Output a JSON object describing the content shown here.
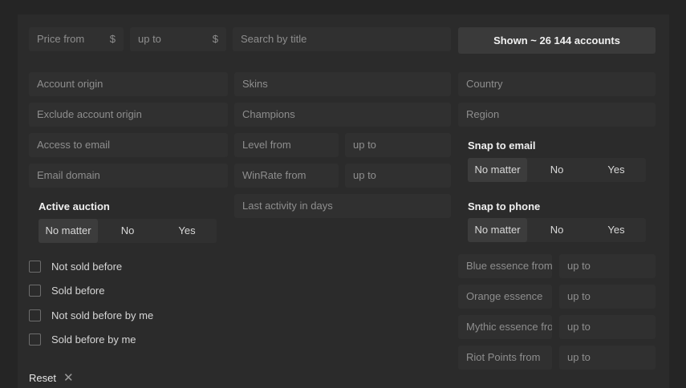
{
  "filters": {
    "price_from": "Price from",
    "price_currency": "$",
    "price_to": "up to",
    "price_to_currency": "$",
    "search_title": "Search by title",
    "shown_button": "Shown ~ 26 144 accounts",
    "account_origin": "Account origin",
    "exclude_account_origin": "Exclude account origin",
    "access_to_email": "Access to email",
    "email_domain": "Email domain",
    "skins": "Skins",
    "champions": "Champions",
    "level_from": "Level from",
    "level_to": "up to",
    "winrate_from": "WinRate from",
    "winrate_to": "up to",
    "last_activity": "Last activity in days",
    "country": "Country",
    "region": "Region",
    "blue_essence_from": "Blue essence from",
    "blue_essence_to": "up to",
    "orange_essence_from": "Orange essence",
    "orange_essence_to": "up to",
    "mythic_essence_from": "Mythic essence from",
    "mythic_essence_to": "up to",
    "riot_points_from": "Riot Points from",
    "riot_points_to": "up to"
  },
  "snap_email": {
    "label": "Snap to email",
    "options": [
      "No matter",
      "No",
      "Yes"
    ],
    "selected": "No matter"
  },
  "snap_phone": {
    "label": "Snap to phone",
    "options": [
      "No matter",
      "No",
      "Yes"
    ],
    "selected": "No matter"
  },
  "active_auction": {
    "label": "Active auction",
    "options": [
      "No matter",
      "No",
      "Yes"
    ],
    "selected": "No matter"
  },
  "checks": [
    {
      "label": "Not sold before",
      "checked": false
    },
    {
      "label": "Sold before",
      "checked": false
    },
    {
      "label": "Not sold before by me",
      "checked": false
    },
    {
      "label": "Sold before by me",
      "checked": false
    }
  ],
  "reset_label": "Reset"
}
